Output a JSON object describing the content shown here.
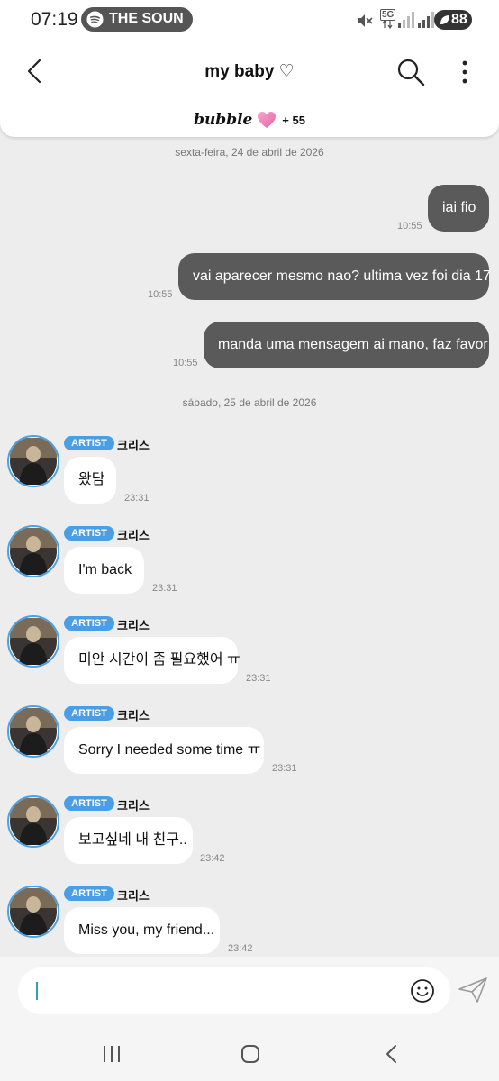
{
  "status_bar": {
    "time": "07:19",
    "spotify_label": "THE SOUN",
    "network": "5G",
    "battery": "88"
  },
  "header": {
    "title": "my baby ♡",
    "bubble_logo": "bubble",
    "bubble_count": "+ 55"
  },
  "chat": {
    "date1": "sexta-feira, 24 de abril de 2026",
    "sent": [
      {
        "text": "iai fio",
        "time": "10:55"
      },
      {
        "text": "vai aparecer mesmo nao? ultima vez foi dia 17",
        "time": "10:55"
      },
      {
        "text": "manda uma mensagem ai mano, faz favor",
        "time": "10:55"
      }
    ],
    "date2": "sábado, 25 de abril de 2026",
    "received": [
      {
        "badge": "ARTIST",
        "sender": "크리스",
        "text": "왔담",
        "time": "23:31"
      },
      {
        "badge": "ARTIST",
        "sender": "크리스",
        "text": "I'm back",
        "time": "23:31"
      },
      {
        "badge": "ARTIST",
        "sender": "크리스",
        "text": "미안 시간이 좀 필요했어 ㅠ",
        "time": "23:31"
      },
      {
        "badge": "ARTIST",
        "sender": "크리스",
        "text": "Sorry I needed some time ㅠ",
        "time": "23:31"
      },
      {
        "badge": "ARTIST",
        "sender": "크리스",
        "text": "보고싶네 내 친구..",
        "time": "23:42"
      },
      {
        "badge": "ARTIST",
        "sender": "크리스",
        "text": "Miss you, my friend...",
        "time": "23:42"
      }
    ]
  },
  "input": {
    "value": ""
  },
  "colors": {
    "accent": "#4a9ee6",
    "sent_bubble": "#5a5a5a",
    "background": "#ededed"
  }
}
